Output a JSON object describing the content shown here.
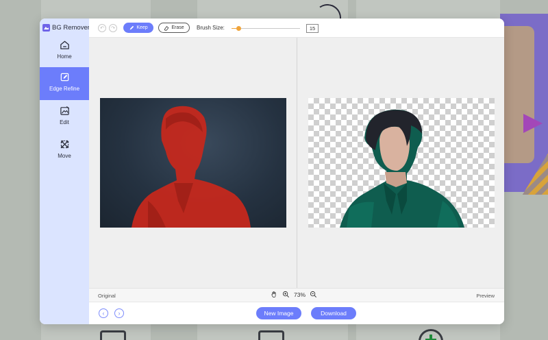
{
  "app": {
    "title": "BG Remover",
    "logo_icon": "image-icon"
  },
  "sidebar": {
    "items": [
      {
        "label": "Home",
        "icon": "home-icon",
        "active": false
      },
      {
        "label": "Edge Refine",
        "icon": "edit-pen-icon",
        "active": true
      },
      {
        "label": "Edit",
        "icon": "image-edit-icon",
        "active": false
      },
      {
        "label": "Move",
        "icon": "move-arrows-icon",
        "active": false
      }
    ]
  },
  "toolbar": {
    "undo_icon": "undo-icon",
    "redo_icon": "redo-icon",
    "keep_label": "Keep",
    "erase_label": "Erase",
    "brush_size_label": "Brush Size:",
    "brush_size_value": "15",
    "brush_size_fraction": 0.1
  },
  "canvas": {
    "original_image": "portrait-with-red-mask",
    "preview_image": "portrait-transparent-background"
  },
  "status": {
    "original_label": "Original",
    "preview_label": "Preview",
    "zoom": "73%",
    "hand_icon": "hand-icon",
    "zoom_in_icon": "zoom-in-icon",
    "zoom_out_icon": "zoom-out-icon"
  },
  "footer": {
    "new_image_label": "New Image",
    "download_label": "Download",
    "prev_icon": "chevron-left-icon",
    "next_icon": "chevron-right-icon"
  },
  "colors": {
    "accent": "#6c7dfb",
    "sidebar_bg": "#dbe4ff",
    "slider": "#f0a43a",
    "mask_red": "#c8281c",
    "shirt_green": "#0f5d4f"
  }
}
